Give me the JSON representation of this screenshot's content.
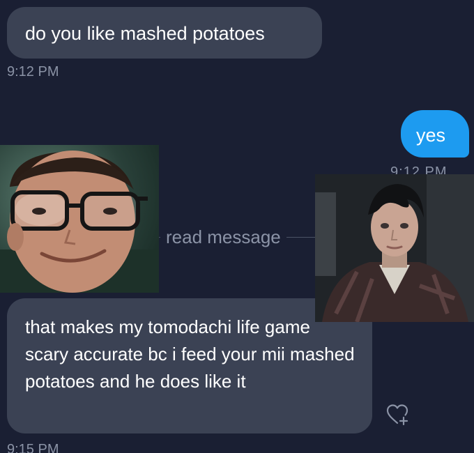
{
  "conversation": {
    "messages": [
      {
        "text": "do you like mashed potatoes",
        "time": "9:12 PM",
        "direction": "incoming"
      },
      {
        "text": "yes",
        "time": "9:12 PM",
        "direction": "outgoing"
      },
      {
        "text": "that makes my tomodachi life game scary accurate bc i feed your mii mashed potatoes and he does like it",
        "time": "9:15 PM",
        "direction": "incoming"
      }
    ],
    "read_divider_label": "read message",
    "like_icon": "heart-plus-icon"
  },
  "colors": {
    "background": "#1a1f33",
    "incoming_bubble": "#3b4254",
    "outgoing_bubble": "#1d9bf0",
    "timestamp_text": "#8b93a6"
  }
}
